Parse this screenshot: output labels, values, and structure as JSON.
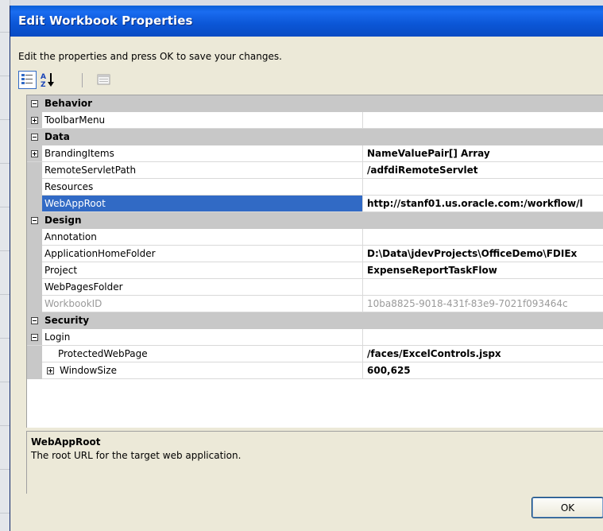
{
  "window": {
    "title": "Edit Workbook Properties"
  },
  "instructions": "Edit the properties and press OK to save your changes.",
  "toolbar": [
    {
      "name": "categorized-view-button",
      "icon": "categorized-icon",
      "active": true
    },
    {
      "name": "alphabetical-sort-button",
      "icon": "sort-az-icon",
      "active": false
    },
    {
      "name": "property-pages-button",
      "icon": "property-pages-icon",
      "active": false
    }
  ],
  "grid": {
    "categories": {
      "behavior": "Behavior",
      "data": "Data",
      "design": "Design",
      "security": "Security"
    },
    "rows": {
      "toolbar_menu": {
        "name": "ToolbarMenu",
        "value": ""
      },
      "branding_items": {
        "name": "BrandingItems",
        "value": "NameValuePair[] Array"
      },
      "remote_servlet_path": {
        "name": "RemoteServletPath",
        "value": "/adfdiRemoteServlet"
      },
      "resources": {
        "name": "Resources",
        "value": ""
      },
      "web_app_root": {
        "name": "WebAppRoot",
        "value": "http://stanf01.us.oracle.com:/workflow/l"
      },
      "annotation": {
        "name": "Annotation",
        "value": ""
      },
      "application_home_folder": {
        "name": "ApplicationHomeFolder",
        "value": "D:\\Data\\jdevProjects\\OfficeDemo\\FDIEx"
      },
      "project": {
        "name": "Project",
        "value": "ExpenseReportTaskFlow"
      },
      "web_pages_folder": {
        "name": "WebPagesFolder",
        "value": ""
      },
      "workbook_id": {
        "name": "WorkbookID",
        "value": "10ba8825-9018-431f-83e9-7021f093464c"
      },
      "login": {
        "name": "Login",
        "value": ""
      },
      "protected_web_page": {
        "name": "ProtectedWebPage",
        "value": "/faces/ExcelControls.jspx"
      },
      "window_size": {
        "name": "WindowSize",
        "value": "600,625"
      }
    },
    "selected_row": "WebAppRoot"
  },
  "description": {
    "title": "WebAppRoot",
    "text": "The root URL for the target web application."
  },
  "buttons": {
    "ok": "OK"
  },
  "colors": {
    "title_bar": "#0a5fd8",
    "selection": "#316ac5",
    "category_bg": "#c8c8c8",
    "dialog_bg": "#ece9d8"
  }
}
